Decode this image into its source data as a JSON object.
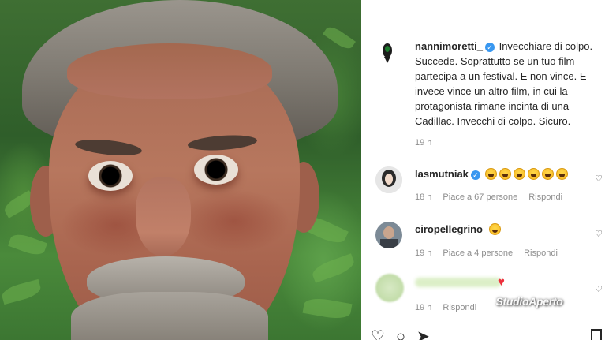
{
  "post": {
    "author": "nannimoretti_",
    "caption": "Invecchiare di colpo. Succede. Soprattutto se un tuo film partecipa a un festival. E non vince. E invece vince un altro film, in cui la protagonista rimane incinta di una Cadillac. Invecchi di colpo. Sicuro.",
    "time": "19 h"
  },
  "comments": [
    {
      "user": "lasmutniak",
      "verified": true,
      "emoji_count": 6,
      "time": "18 h",
      "likes": "Piace a 67 persone",
      "reply": "Rispondi"
    },
    {
      "user": "ciropellegrino",
      "verified": false,
      "emoji_count": 1,
      "time": "19 h",
      "likes": "Piace a 4 persone",
      "reply": "Rispondi"
    },
    {
      "time": "19 h",
      "reply": "Rispondi"
    }
  ],
  "watermark": "StudioAperto",
  "colors": {
    "verified": "#3897f0",
    "heart": "#ed2f3c",
    "meta": "#8e8e8e",
    "text": "#262626"
  },
  "icons": [
    "heart-icon",
    "comment-icon",
    "share-icon",
    "bookmark-icon",
    "verified-badge-icon"
  ]
}
